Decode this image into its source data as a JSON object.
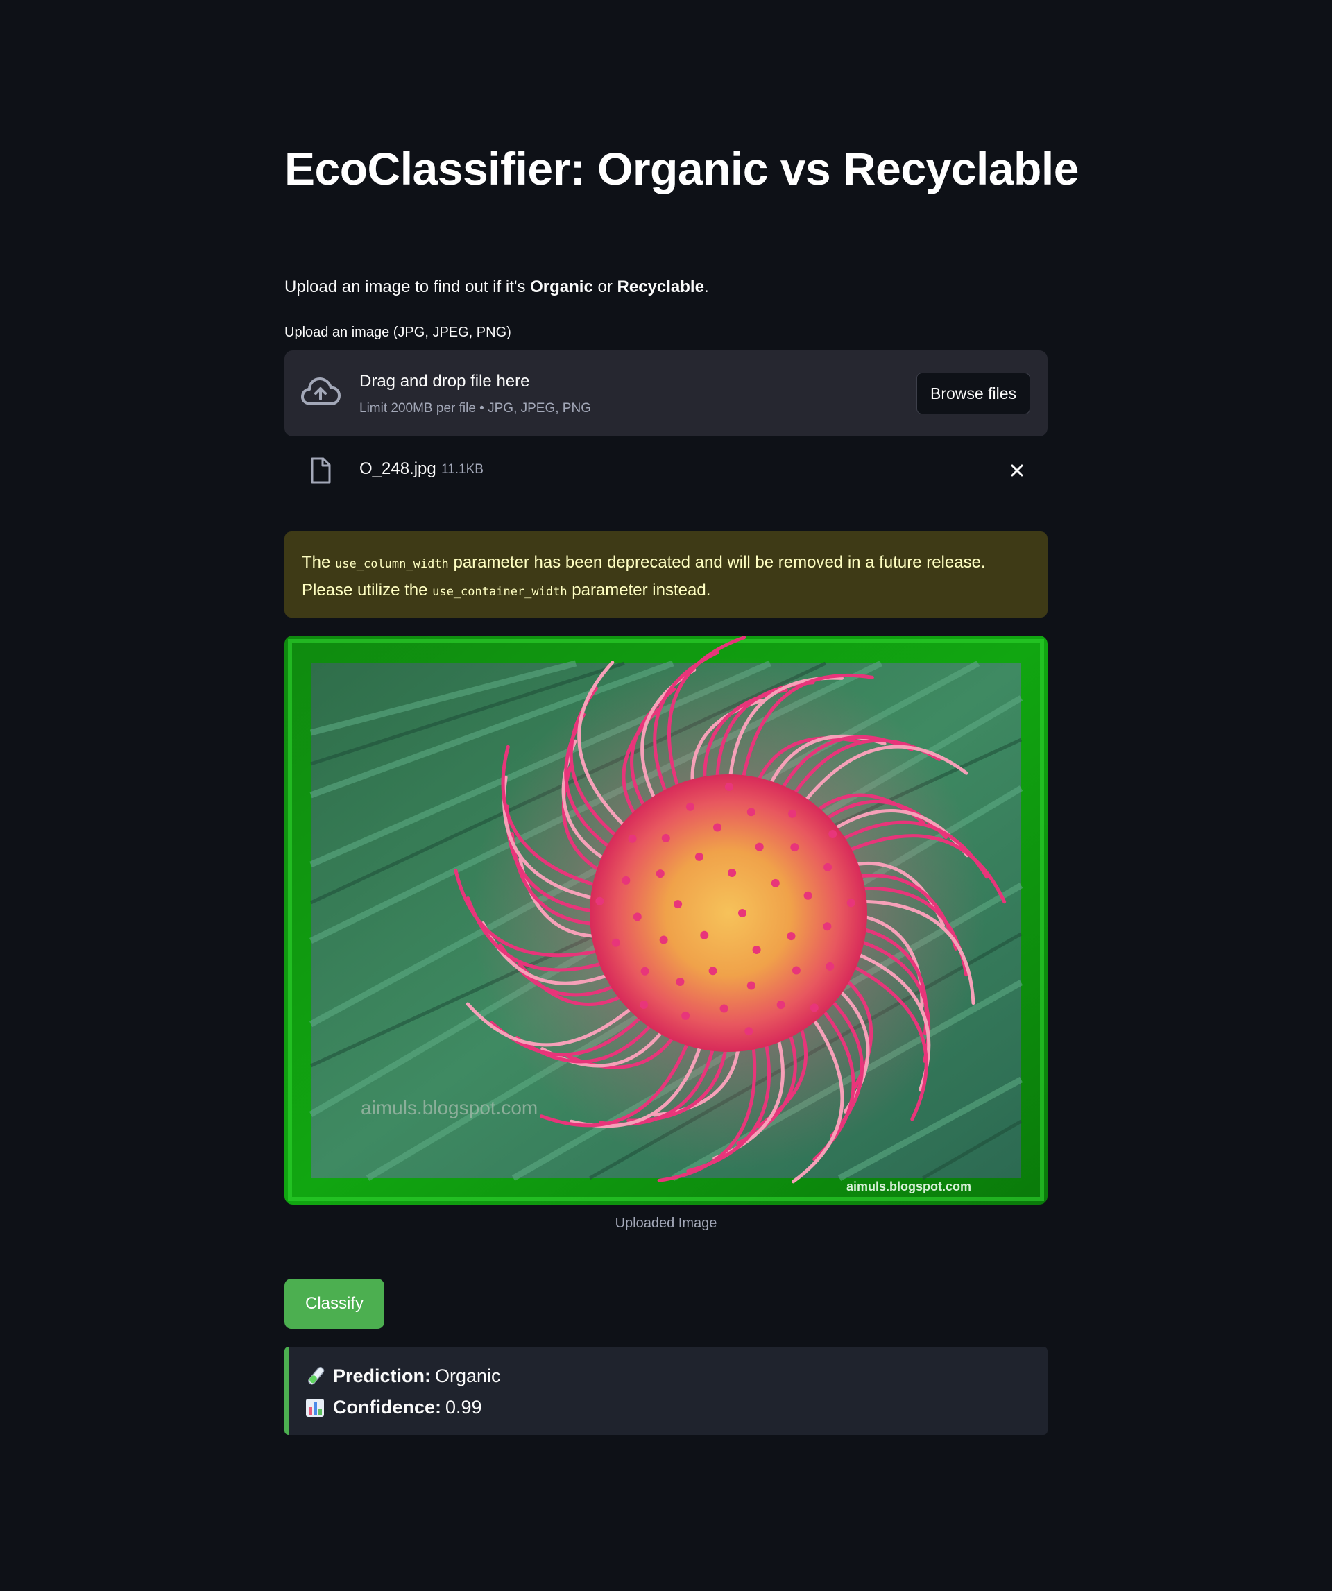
{
  "page": {
    "title": "EcoClassifier: Organic vs Recyclable",
    "intro": {
      "prefix": "Upload an image to find out if it's ",
      "organic": "Organic",
      "middle": " or ",
      "recyclable": "Recyclable",
      "suffix": "."
    }
  },
  "uploader": {
    "label": "Upload an image (JPG, JPEG, PNG)",
    "drop_title": "Drag and drop file here",
    "drop_subtitle": "Limit 200MB per file • JPG, JPEG, PNG",
    "browse_label": "Browse files",
    "icon": "cloud-upload-icon",
    "file": {
      "name": "O_248.jpg",
      "size": "11.1KB",
      "icon": "file-icon",
      "remove_icon": "close-icon"
    }
  },
  "warning": {
    "part1": "The ",
    "code1": "use_column_width",
    "part2": " parameter has been deprecated and will be removed in a future release. Please utilize the ",
    "code2": "use_container_width",
    "part3": " parameter instead."
  },
  "image": {
    "caption": "Uploaded Image",
    "watermark_main": "aimuls.blogspot.com",
    "watermark_corner": "aimuls.blogspot.com"
  },
  "classify": {
    "label": "Classify"
  },
  "result": {
    "prediction_label": "Prediction:",
    "prediction_value": "Organic",
    "confidence_label": "Confidence:",
    "confidence_value": "0.99",
    "prediction_icon": "test-tube-icon",
    "confidence_icon": "bar-chart-icon"
  },
  "colors": {
    "background": "#0e1117",
    "panel": "#262730",
    "warning_bg": "#3e3a16",
    "warning_text": "#ffffc2",
    "accent_green": "#4caf50",
    "result_bg": "#1f232d"
  }
}
